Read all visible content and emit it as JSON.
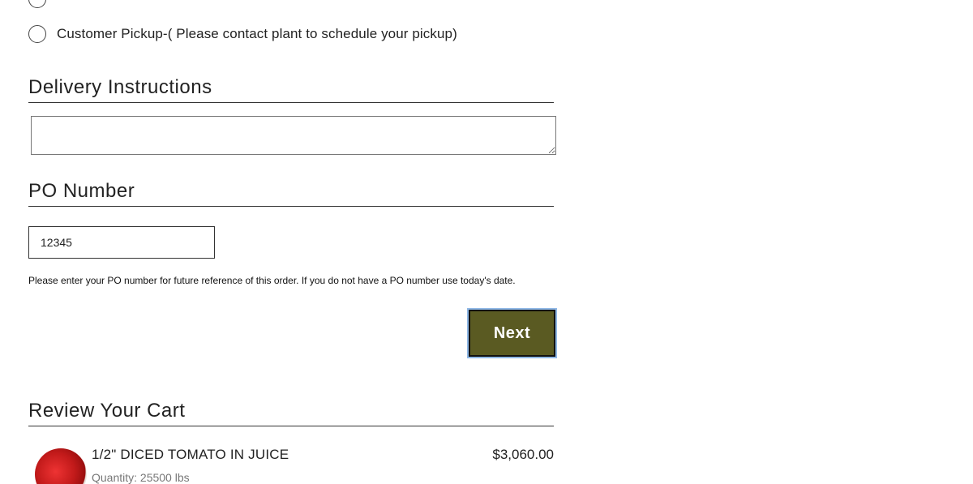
{
  "shipping_options": {
    "partial_option_label": "",
    "pickup_label": "Customer Pickup-( Please contact plant to schedule your pickup)"
  },
  "delivery": {
    "heading": "Delivery Instructions",
    "value": ""
  },
  "po": {
    "heading": "PO Number",
    "value": "12345",
    "help_text": "Please enter your PO number for future reference of this order. If you do not have a PO number use today's date."
  },
  "actions": {
    "next_label": "Next"
  },
  "cart": {
    "heading": "Review Your Cart",
    "items": [
      {
        "name": "1/2\" DICED TOMATO IN JUICE",
        "quantity": "Quantity: 25500 lbs",
        "price": "$3,060.00"
      }
    ]
  },
  "colors": {
    "button_bg": "#5a5a22",
    "focus_ring": "#8fb8e6"
  }
}
